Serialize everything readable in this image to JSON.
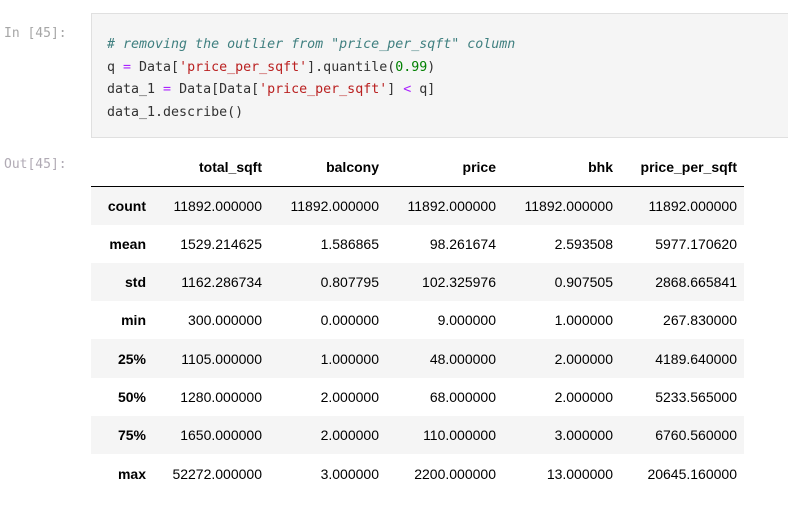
{
  "input_cell": {
    "prompt": "In [45]:",
    "code": {
      "line1": "# removing the outlier from \"price_per_sqft\" column",
      "line2": {
        "a": "q ",
        "op": "=",
        "b": " Data[",
        "str": "'price_per_sqft'",
        "c": "].quantile(",
        "num": "0.99",
        "d": ")"
      },
      "line3": {
        "a": "data_1 ",
        "op": "=",
        "b": " Data[Data[",
        "str": "'price_per_sqft'",
        "c": "] ",
        "op2": "<",
        "d": " q]"
      },
      "line4": "data_1.describe()"
    }
  },
  "output_cell": {
    "prompt": "Out[45]:",
    "table": {
      "columns": [
        "",
        "total_sqft",
        "balcony",
        "price",
        "bhk",
        "price_per_sqft"
      ],
      "rows": [
        {
          "index": "count",
          "values": [
            "11892.000000",
            "11892.000000",
            "11892.000000",
            "11892.000000",
            "11892.000000"
          ]
        },
        {
          "index": "mean",
          "values": [
            "1529.214625",
            "1.586865",
            "98.261674",
            "2.593508",
            "5977.170620"
          ]
        },
        {
          "index": "std",
          "values": [
            "1162.286734",
            "0.807795",
            "102.325976",
            "0.907505",
            "2868.665841"
          ]
        },
        {
          "index": "min",
          "values": [
            "300.000000",
            "0.000000",
            "9.000000",
            "1.000000",
            "267.830000"
          ]
        },
        {
          "index": "25%",
          "values": [
            "1105.000000",
            "1.000000",
            "48.000000",
            "2.000000",
            "4189.640000"
          ]
        },
        {
          "index": "50%",
          "values": [
            "1280.000000",
            "2.000000",
            "68.000000",
            "2.000000",
            "5233.565000"
          ]
        },
        {
          "index": "75%",
          "values": [
            "1650.000000",
            "2.000000",
            "110.000000",
            "3.000000",
            "6760.560000"
          ]
        },
        {
          "index": "max",
          "values": [
            "52272.000000",
            "3.000000",
            "2200.000000",
            "13.000000",
            "20645.160000"
          ]
        }
      ]
    }
  }
}
